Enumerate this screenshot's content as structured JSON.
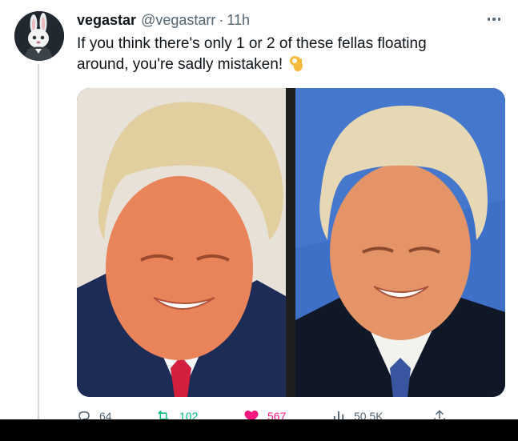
{
  "tweet": {
    "display_name": "vegastar",
    "handle": "@vegastarr",
    "separator": "·",
    "time": "11h",
    "text": "If you think there's only 1 or 2 of these fellas floating around, you're sadly mistaken!",
    "emoji": "ok-hand"
  },
  "actions": {
    "replies": "64",
    "retweets": "102",
    "likes": "567",
    "views": "50.5K"
  },
  "colors": {
    "retweet_green": "#00ba7c",
    "like_pink": "#f91880",
    "secondary_gray": "#536471",
    "left_photo_bg": "#e7e1d8",
    "right_photo_bg": "#3f70c8"
  },
  "icons": [
    "more-icon",
    "ok-hand-emoji",
    "reply-icon",
    "retweet-icon",
    "like-icon",
    "views-icon",
    "share-icon"
  ]
}
